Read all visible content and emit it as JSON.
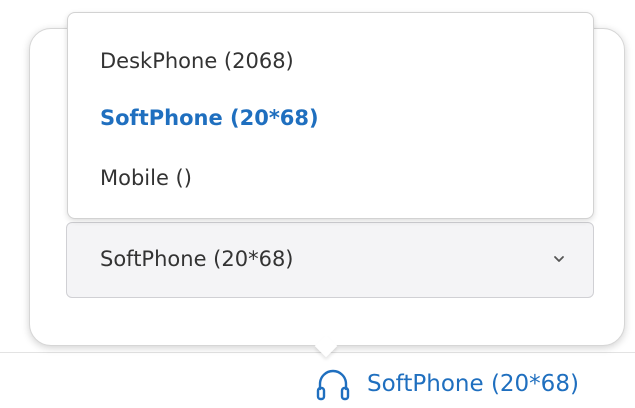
{
  "device_picker": {
    "options": [
      {
        "label": "DeskPhone (2068)",
        "selected": false
      },
      {
        "label": "SoftPhone (20*68)",
        "selected": true
      },
      {
        "label": "Mobile ()",
        "selected": false
      }
    ],
    "selected_value": "SoftPhone (20*68)"
  },
  "status_bar": {
    "active_device_label": "SoftPhone (20*68)",
    "icon": "headset-icon"
  },
  "colors": {
    "accent": "#1f6fbf",
    "text": "#333333",
    "select_bg": "#f4f4f6"
  }
}
